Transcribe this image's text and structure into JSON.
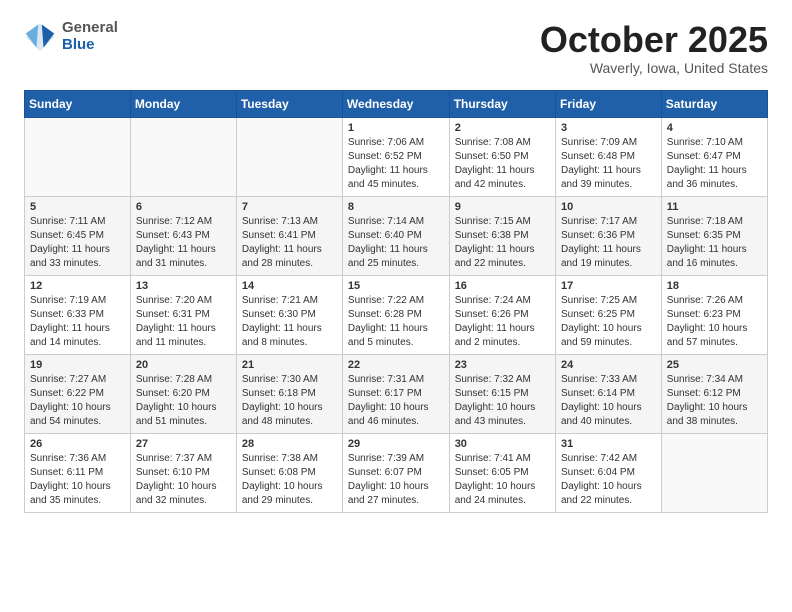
{
  "logo": {
    "general": "General",
    "blue": "Blue"
  },
  "header": {
    "month": "October 2025",
    "location": "Waverly, Iowa, United States"
  },
  "weekdays": [
    "Sunday",
    "Monday",
    "Tuesday",
    "Wednesday",
    "Thursday",
    "Friday",
    "Saturday"
  ],
  "weeks": [
    [
      {
        "day": "",
        "sunrise": "",
        "sunset": "",
        "daylight": ""
      },
      {
        "day": "",
        "sunrise": "",
        "sunset": "",
        "daylight": ""
      },
      {
        "day": "",
        "sunrise": "",
        "sunset": "",
        "daylight": ""
      },
      {
        "day": "1",
        "sunrise": "Sunrise: 7:06 AM",
        "sunset": "Sunset: 6:52 PM",
        "daylight": "Daylight: 11 hours and 45 minutes."
      },
      {
        "day": "2",
        "sunrise": "Sunrise: 7:08 AM",
        "sunset": "Sunset: 6:50 PM",
        "daylight": "Daylight: 11 hours and 42 minutes."
      },
      {
        "day": "3",
        "sunrise": "Sunrise: 7:09 AM",
        "sunset": "Sunset: 6:48 PM",
        "daylight": "Daylight: 11 hours and 39 minutes."
      },
      {
        "day": "4",
        "sunrise": "Sunrise: 7:10 AM",
        "sunset": "Sunset: 6:47 PM",
        "daylight": "Daylight: 11 hours and 36 minutes."
      }
    ],
    [
      {
        "day": "5",
        "sunrise": "Sunrise: 7:11 AM",
        "sunset": "Sunset: 6:45 PM",
        "daylight": "Daylight: 11 hours and 33 minutes."
      },
      {
        "day": "6",
        "sunrise": "Sunrise: 7:12 AM",
        "sunset": "Sunset: 6:43 PM",
        "daylight": "Daylight: 11 hours and 31 minutes."
      },
      {
        "day": "7",
        "sunrise": "Sunrise: 7:13 AM",
        "sunset": "Sunset: 6:41 PM",
        "daylight": "Daylight: 11 hours and 28 minutes."
      },
      {
        "day": "8",
        "sunrise": "Sunrise: 7:14 AM",
        "sunset": "Sunset: 6:40 PM",
        "daylight": "Daylight: 11 hours and 25 minutes."
      },
      {
        "day": "9",
        "sunrise": "Sunrise: 7:15 AM",
        "sunset": "Sunset: 6:38 PM",
        "daylight": "Daylight: 11 hours and 22 minutes."
      },
      {
        "day": "10",
        "sunrise": "Sunrise: 7:17 AM",
        "sunset": "Sunset: 6:36 PM",
        "daylight": "Daylight: 11 hours and 19 minutes."
      },
      {
        "day": "11",
        "sunrise": "Sunrise: 7:18 AM",
        "sunset": "Sunset: 6:35 PM",
        "daylight": "Daylight: 11 hours and 16 minutes."
      }
    ],
    [
      {
        "day": "12",
        "sunrise": "Sunrise: 7:19 AM",
        "sunset": "Sunset: 6:33 PM",
        "daylight": "Daylight: 11 hours and 14 minutes."
      },
      {
        "day": "13",
        "sunrise": "Sunrise: 7:20 AM",
        "sunset": "Sunset: 6:31 PM",
        "daylight": "Daylight: 11 hours and 11 minutes."
      },
      {
        "day": "14",
        "sunrise": "Sunrise: 7:21 AM",
        "sunset": "Sunset: 6:30 PM",
        "daylight": "Daylight: 11 hours and 8 minutes."
      },
      {
        "day": "15",
        "sunrise": "Sunrise: 7:22 AM",
        "sunset": "Sunset: 6:28 PM",
        "daylight": "Daylight: 11 hours and 5 minutes."
      },
      {
        "day": "16",
        "sunrise": "Sunrise: 7:24 AM",
        "sunset": "Sunset: 6:26 PM",
        "daylight": "Daylight: 11 hours and 2 minutes."
      },
      {
        "day": "17",
        "sunrise": "Sunrise: 7:25 AM",
        "sunset": "Sunset: 6:25 PM",
        "daylight": "Daylight: 10 hours and 59 minutes."
      },
      {
        "day": "18",
        "sunrise": "Sunrise: 7:26 AM",
        "sunset": "Sunset: 6:23 PM",
        "daylight": "Daylight: 10 hours and 57 minutes."
      }
    ],
    [
      {
        "day": "19",
        "sunrise": "Sunrise: 7:27 AM",
        "sunset": "Sunset: 6:22 PM",
        "daylight": "Daylight: 10 hours and 54 minutes."
      },
      {
        "day": "20",
        "sunrise": "Sunrise: 7:28 AM",
        "sunset": "Sunset: 6:20 PM",
        "daylight": "Daylight: 10 hours and 51 minutes."
      },
      {
        "day": "21",
        "sunrise": "Sunrise: 7:30 AM",
        "sunset": "Sunset: 6:18 PM",
        "daylight": "Daylight: 10 hours and 48 minutes."
      },
      {
        "day": "22",
        "sunrise": "Sunrise: 7:31 AM",
        "sunset": "Sunset: 6:17 PM",
        "daylight": "Daylight: 10 hours and 46 minutes."
      },
      {
        "day": "23",
        "sunrise": "Sunrise: 7:32 AM",
        "sunset": "Sunset: 6:15 PM",
        "daylight": "Daylight: 10 hours and 43 minutes."
      },
      {
        "day": "24",
        "sunrise": "Sunrise: 7:33 AM",
        "sunset": "Sunset: 6:14 PM",
        "daylight": "Daylight: 10 hours and 40 minutes."
      },
      {
        "day": "25",
        "sunrise": "Sunrise: 7:34 AM",
        "sunset": "Sunset: 6:12 PM",
        "daylight": "Daylight: 10 hours and 38 minutes."
      }
    ],
    [
      {
        "day": "26",
        "sunrise": "Sunrise: 7:36 AM",
        "sunset": "Sunset: 6:11 PM",
        "daylight": "Daylight: 10 hours and 35 minutes."
      },
      {
        "day": "27",
        "sunrise": "Sunrise: 7:37 AM",
        "sunset": "Sunset: 6:10 PM",
        "daylight": "Daylight: 10 hours and 32 minutes."
      },
      {
        "day": "28",
        "sunrise": "Sunrise: 7:38 AM",
        "sunset": "Sunset: 6:08 PM",
        "daylight": "Daylight: 10 hours and 29 minutes."
      },
      {
        "day": "29",
        "sunrise": "Sunrise: 7:39 AM",
        "sunset": "Sunset: 6:07 PM",
        "daylight": "Daylight: 10 hours and 27 minutes."
      },
      {
        "day": "30",
        "sunrise": "Sunrise: 7:41 AM",
        "sunset": "Sunset: 6:05 PM",
        "daylight": "Daylight: 10 hours and 24 minutes."
      },
      {
        "day": "31",
        "sunrise": "Sunrise: 7:42 AM",
        "sunset": "Sunset: 6:04 PM",
        "daylight": "Daylight: 10 hours and 22 minutes."
      },
      {
        "day": "",
        "sunrise": "",
        "sunset": "",
        "daylight": ""
      }
    ]
  ]
}
